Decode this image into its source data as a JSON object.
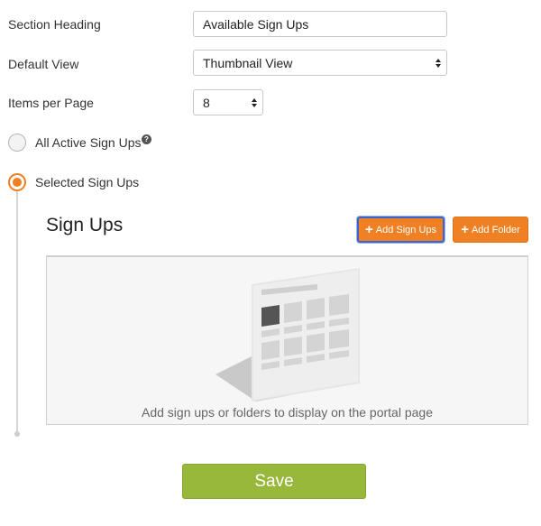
{
  "form": {
    "section_heading": {
      "label": "Section Heading",
      "value": "Available Sign Ups"
    },
    "default_view": {
      "label": "Default View",
      "value": "Thumbnail View"
    },
    "items_per_page": {
      "label": "Items per Page",
      "value": "8"
    },
    "options": [
      {
        "label": "All Active Sign Ups",
        "checked": false,
        "help_icon": "question-circle-icon"
      },
      {
        "label": "Selected Sign Ups",
        "checked": true
      }
    ]
  },
  "panel": {
    "title": "Sign Ups",
    "add_signups_label": "Add Sign Ups",
    "add_folder_label": "Add Folder",
    "empty_message": "Add sign ups or folders to display on the portal page"
  },
  "save_label": "Save",
  "colors": {
    "accent": "#f08024",
    "save": "#97b83a",
    "focus_ring": "#3b66c8"
  }
}
